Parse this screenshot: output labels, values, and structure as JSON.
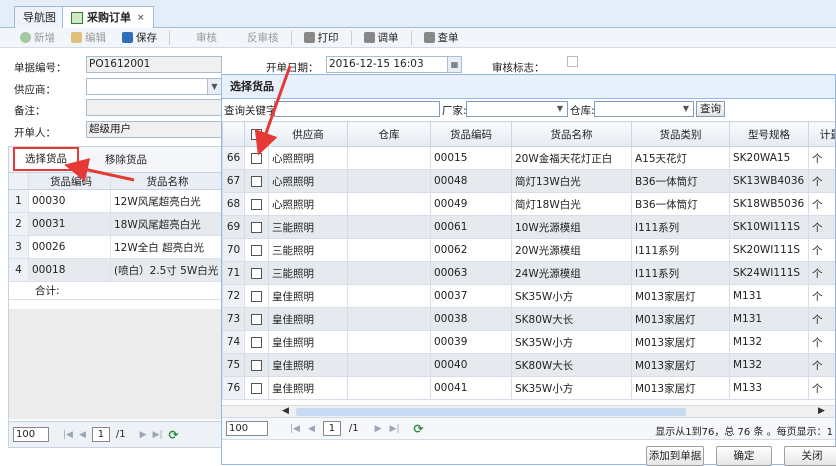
{
  "tabs": [
    {
      "label": "导航图"
    },
    {
      "label": "采购订单",
      "close": "×"
    }
  ],
  "toolbar": {
    "new": "新增",
    "edit": "编辑",
    "save": "保存",
    "audit": "审核",
    "unaudit": "反审核",
    "print": "打印",
    "transfer": "调单",
    "query": "查单"
  },
  "form": {
    "order_no_label": "单据编号：",
    "order_no": "PO1612001",
    "date_label": "开单日期：",
    "date": "2016-12-15 16:03",
    "audit_label": "审核标志：",
    "supplier_label": "供应商：",
    "supplier": "",
    "remark_label": "备注：",
    "remark": "",
    "creator_label": "开单人：",
    "creator": "超级用户"
  },
  "left": {
    "tab_select": "选择货品",
    "tab_remove": "移除货品",
    "headers": {
      "code": "货品编码",
      "name": "货品名称"
    },
    "rows": [
      {
        "no": "1",
        "code": "00030",
        "name": "12W风尾超亮白光"
      },
      {
        "no": "2",
        "code": "00031",
        "name": "18W风尾超亮白光"
      },
      {
        "no": "3",
        "code": "00026",
        "name": "12W全白 超亮白光"
      },
      {
        "no": "4",
        "code": "00018",
        "name": "(喷白）2.5寸 5W白光"
      }
    ],
    "sum_label": "合计:",
    "pager": {
      "size": "100",
      "page": "1",
      "of": "/1"
    }
  },
  "dialog": {
    "title": "选择货品",
    "search": {
      "keyword_label": "查询关键字",
      "vendor_label": "厂家:",
      "warehouse_label": "仓库:",
      "query_btn": "查询"
    },
    "headers": [
      "供应商",
      "仓库",
      "货品编码",
      "货品名称",
      "货品类别",
      "型号规格",
      "计量单"
    ],
    "rows": [
      {
        "n": "66",
        "supplier": "心照照明",
        "wh": "",
        "code": "00015",
        "name": "20W金福天花灯正白",
        "cat": "A15天花灯",
        "model": "SK20WA15",
        "unit": "个"
      },
      {
        "n": "67",
        "supplier": "心照照明",
        "wh": "",
        "code": "00048",
        "name": "简灯13W白光",
        "cat": "B36一体筒灯",
        "model": "SK13WB4036",
        "unit": "个"
      },
      {
        "n": "68",
        "supplier": "心照照明",
        "wh": "",
        "code": "00049",
        "name": "简灯18W白光",
        "cat": "B36一体筒灯",
        "model": "SK18WB5036",
        "unit": "个"
      },
      {
        "n": "69",
        "supplier": "三能照明",
        "wh": "",
        "code": "00061",
        "name": "10W光源模组",
        "cat": "I111系列",
        "model": "SK10WI111S",
        "unit": "个"
      },
      {
        "n": "70",
        "supplier": "三能照明",
        "wh": "",
        "code": "00062",
        "name": "20W光源模组",
        "cat": "I111系列",
        "model": "SK20WI111S",
        "unit": "个"
      },
      {
        "n": "71",
        "supplier": "三能照明",
        "wh": "",
        "code": "00063",
        "name": "24W光源模组",
        "cat": "I111系列",
        "model": "SK24WI111S",
        "unit": "个"
      },
      {
        "n": "72",
        "supplier": "皇佳照明",
        "wh": "",
        "code": "00037",
        "name": "SK35W小方",
        "cat": "M013家居灯",
        "model": "M131",
        "unit": "个"
      },
      {
        "n": "73",
        "supplier": "皇佳照明",
        "wh": "",
        "code": "00038",
        "name": "SK80W大长",
        "cat": "M013家居灯",
        "model": "M131",
        "unit": "个"
      },
      {
        "n": "74",
        "supplier": "皇佳照明",
        "wh": "",
        "code": "00039",
        "name": "SK35W小方",
        "cat": "M013家居灯",
        "model": "M132",
        "unit": "个"
      },
      {
        "n": "75",
        "supplier": "皇佳照明",
        "wh": "",
        "code": "00040",
        "name": "SK80W大长",
        "cat": "M013家居灯",
        "model": "M132",
        "unit": "个"
      },
      {
        "n": "76",
        "supplier": "皇佳照明",
        "wh": "",
        "code": "00041",
        "name": "SK35W小方",
        "cat": "M013家居灯",
        "model": "M133",
        "unit": "个"
      }
    ],
    "pager": {
      "size": "100",
      "page": "1",
      "of": "/1",
      "info": "显示从1到76，总 76 条 。每页显示：1"
    },
    "footer": {
      "add": "添加到单据",
      "ok": "确定",
      "close": "关闭"
    }
  },
  "colors": {
    "accent": "#95b8e7",
    "highlight": "#e53935"
  }
}
